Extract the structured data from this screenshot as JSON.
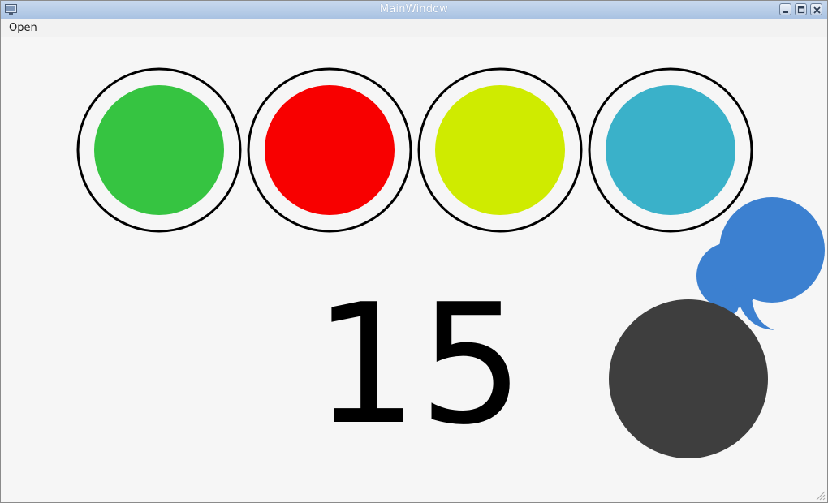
{
  "window": {
    "title": "MainWindow"
  },
  "menu": {
    "items": [
      "Open"
    ]
  },
  "lights": [
    {
      "name": "green",
      "color": "#36c441"
    },
    {
      "name": "red",
      "color": "#f80000"
    },
    {
      "name": "yellow",
      "color": "#cfeb00"
    },
    {
      "name": "cyan",
      "color": "#3ab1c9"
    }
  ],
  "counter": {
    "value": "15"
  },
  "colors": {
    "ring": "#000000",
    "speech_bubble": "#3c80d0",
    "dark_circle": "#3e3e3e",
    "background": "#f6f6f6"
  },
  "icons": {
    "title_icon": "app-window-icon",
    "minimize": "minimize-icon",
    "maximize": "maximize-icon",
    "close": "close-icon",
    "speech": "speech-bubble-icon",
    "resize": "resize-grip-icon"
  }
}
